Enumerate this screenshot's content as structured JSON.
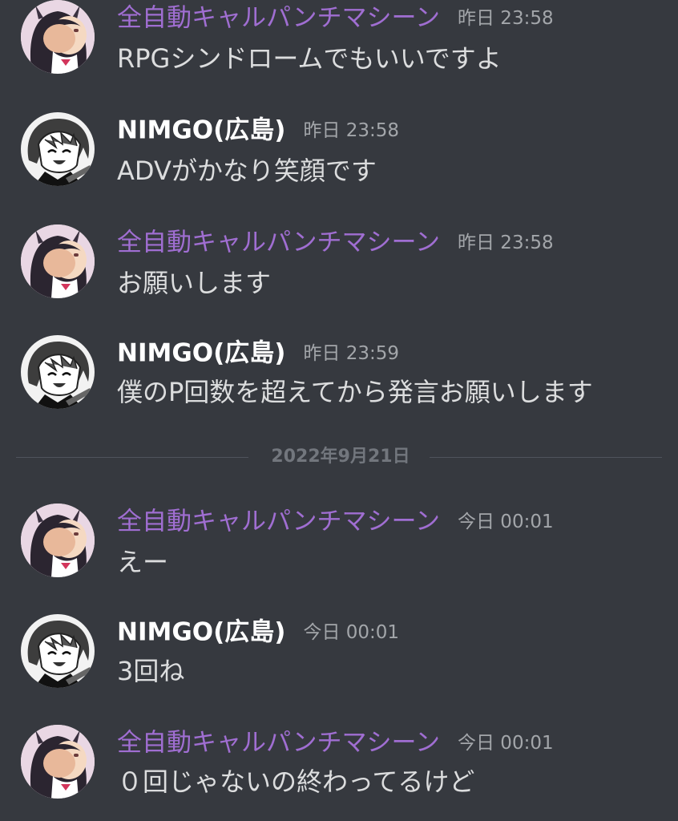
{
  "messages": [
    {
      "author": "全自動キャルパンチマシーン",
      "timestamp": "昨日 23:58",
      "content": "RPGシンドロームでもいいですよ"
    },
    {
      "author": "NIMGO(広島)",
      "timestamp": "昨日 23:58",
      "content": "ADVがかなり笑顔です"
    },
    {
      "author": "全自動キャルパンチマシーン",
      "timestamp": "昨日 23:58",
      "content": "お願いします"
    },
    {
      "author": "NIMGO(広島)",
      "timestamp": "昨日 23:59",
      "content": "僕のP回数を超えてから発言お願いします"
    },
    {
      "author": "全自動キャルパンチマシーン",
      "timestamp": "今日 00:01",
      "content": "えー"
    },
    {
      "author": "NIMGO(広島)",
      "timestamp": "今日 00:01",
      "content": "3回ね"
    },
    {
      "author": "全自動キャルパンチマシーン",
      "timestamp": "今日 00:01",
      "content": "０回じゃないの終わってるけど"
    }
  ],
  "date_divider": {
    "label": "2022年9月21日"
  },
  "colors": {
    "background": "#36393f",
    "author_purple": "#a06ed2",
    "author_white": "#ffffff",
    "timestamp": "#a3a6aa",
    "content": "#dcddde",
    "divider": "#4f545c"
  },
  "icons": {
    "avatar_a": "anime-girl-avatar",
    "avatar_b": "anime-boy-manga-avatar"
  }
}
